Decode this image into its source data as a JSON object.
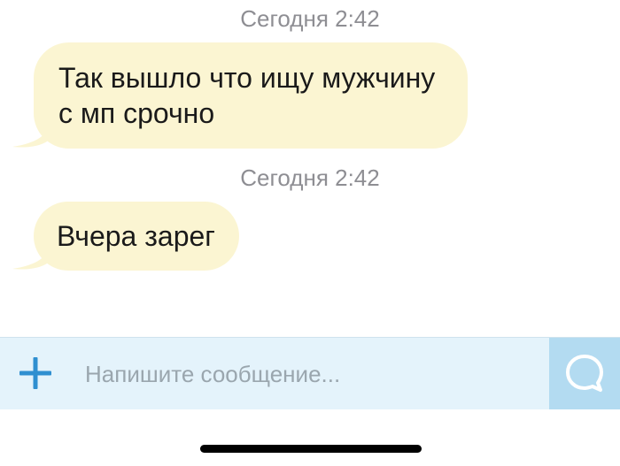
{
  "messages": [
    {
      "timestamp": "Сегодня 2:42",
      "line1": "Так вышло что ищу мужчину",
      "line2": "с мп срочно"
    },
    {
      "timestamp": "Сегодня 2:42",
      "line1": "Вчера зарег"
    }
  ],
  "composer": {
    "add_icon": "plus-icon",
    "placeholder": "Напишите сообщение...",
    "value": "",
    "send_icon": "chat-bubble-icon"
  },
  "colors": {
    "bubble_bg": "#fbf5d2",
    "composer_bg": "#e4f3fb",
    "send_bg": "#b3dbf1",
    "plus": "#2f8fd0",
    "timestamp": "#8e8e93"
  }
}
